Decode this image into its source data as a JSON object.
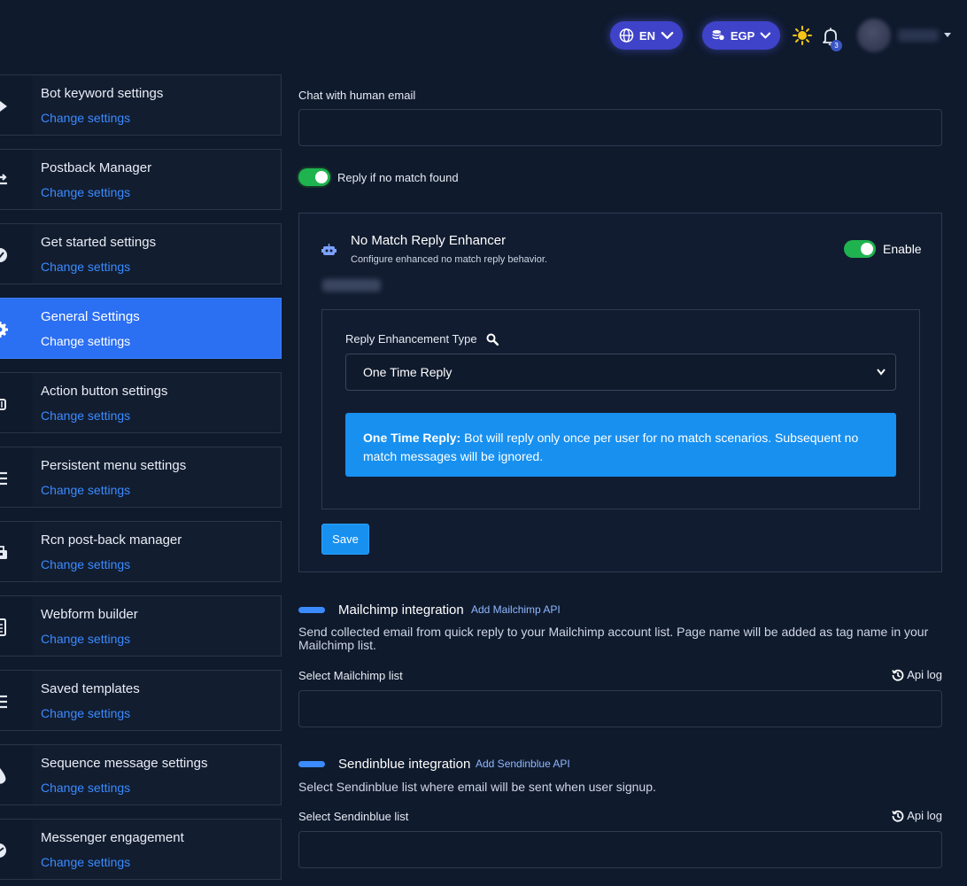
{
  "topbar": {
    "language": "EN",
    "currency": "EGP",
    "notification_count": "3"
  },
  "sidebar": {
    "items": [
      {
        "title": "Bot keyword settings",
        "link": "Change settings"
      },
      {
        "title": "Postback Manager",
        "link": "Change settings"
      },
      {
        "title": "Get started settings",
        "link": "Change settings"
      },
      {
        "title": "General Settings",
        "link": "Change settings"
      },
      {
        "title": "Action button settings",
        "link": "Change settings"
      },
      {
        "title": "Persistent menu settings",
        "link": "Change settings"
      },
      {
        "title": "Rcn post-back manager",
        "link": "Change settings"
      },
      {
        "title": "Webform builder",
        "link": "Change settings"
      },
      {
        "title": "Saved templates",
        "link": "Change settings"
      },
      {
        "title": "Sequence message settings",
        "link": "Change settings"
      },
      {
        "title": "Messenger engagement",
        "link": "Change settings"
      }
    ]
  },
  "main": {
    "chat_email_label": "Chat with human email",
    "chat_email_value": "",
    "reply_toggle_label": "Reply if no match found",
    "enhancer": {
      "title": "No Match Reply Enhancer",
      "subtitle": "Configure enhanced no match reply behavior.",
      "enable_label": "Enable",
      "type_label": "Reply Enhancement Type",
      "type_selected": "One Time Reply",
      "info_bold": "One Time Reply:",
      "info_text": " Bot will reply only once per user for no match scenarios. Subsequent no match messages will be ignored.",
      "save_label": "Save"
    },
    "mailchimp": {
      "title": "Mailchimp integration",
      "add_link": "Add Mailchimp API",
      "description": "Send collected email from quick reply to your Mailchimp account list. Page name will be added as tag name in your Mailchimp list.",
      "select_label": "Select Mailchimp list",
      "api_log": "Api log"
    },
    "sendinblue": {
      "title": "Sendinblue integration",
      "add_link": "Add Sendinblue API",
      "description": "Select Sendinblue list where email will be sent when user signup.",
      "select_label": "Select Sendinblue list",
      "api_log": "Api log"
    }
  },
  "colors": {
    "background": "#0f1a2d",
    "accent": "#2b6ff3",
    "link": "#3b8bff",
    "toggle_on": "#1fb34f",
    "info": "#1790f0"
  }
}
